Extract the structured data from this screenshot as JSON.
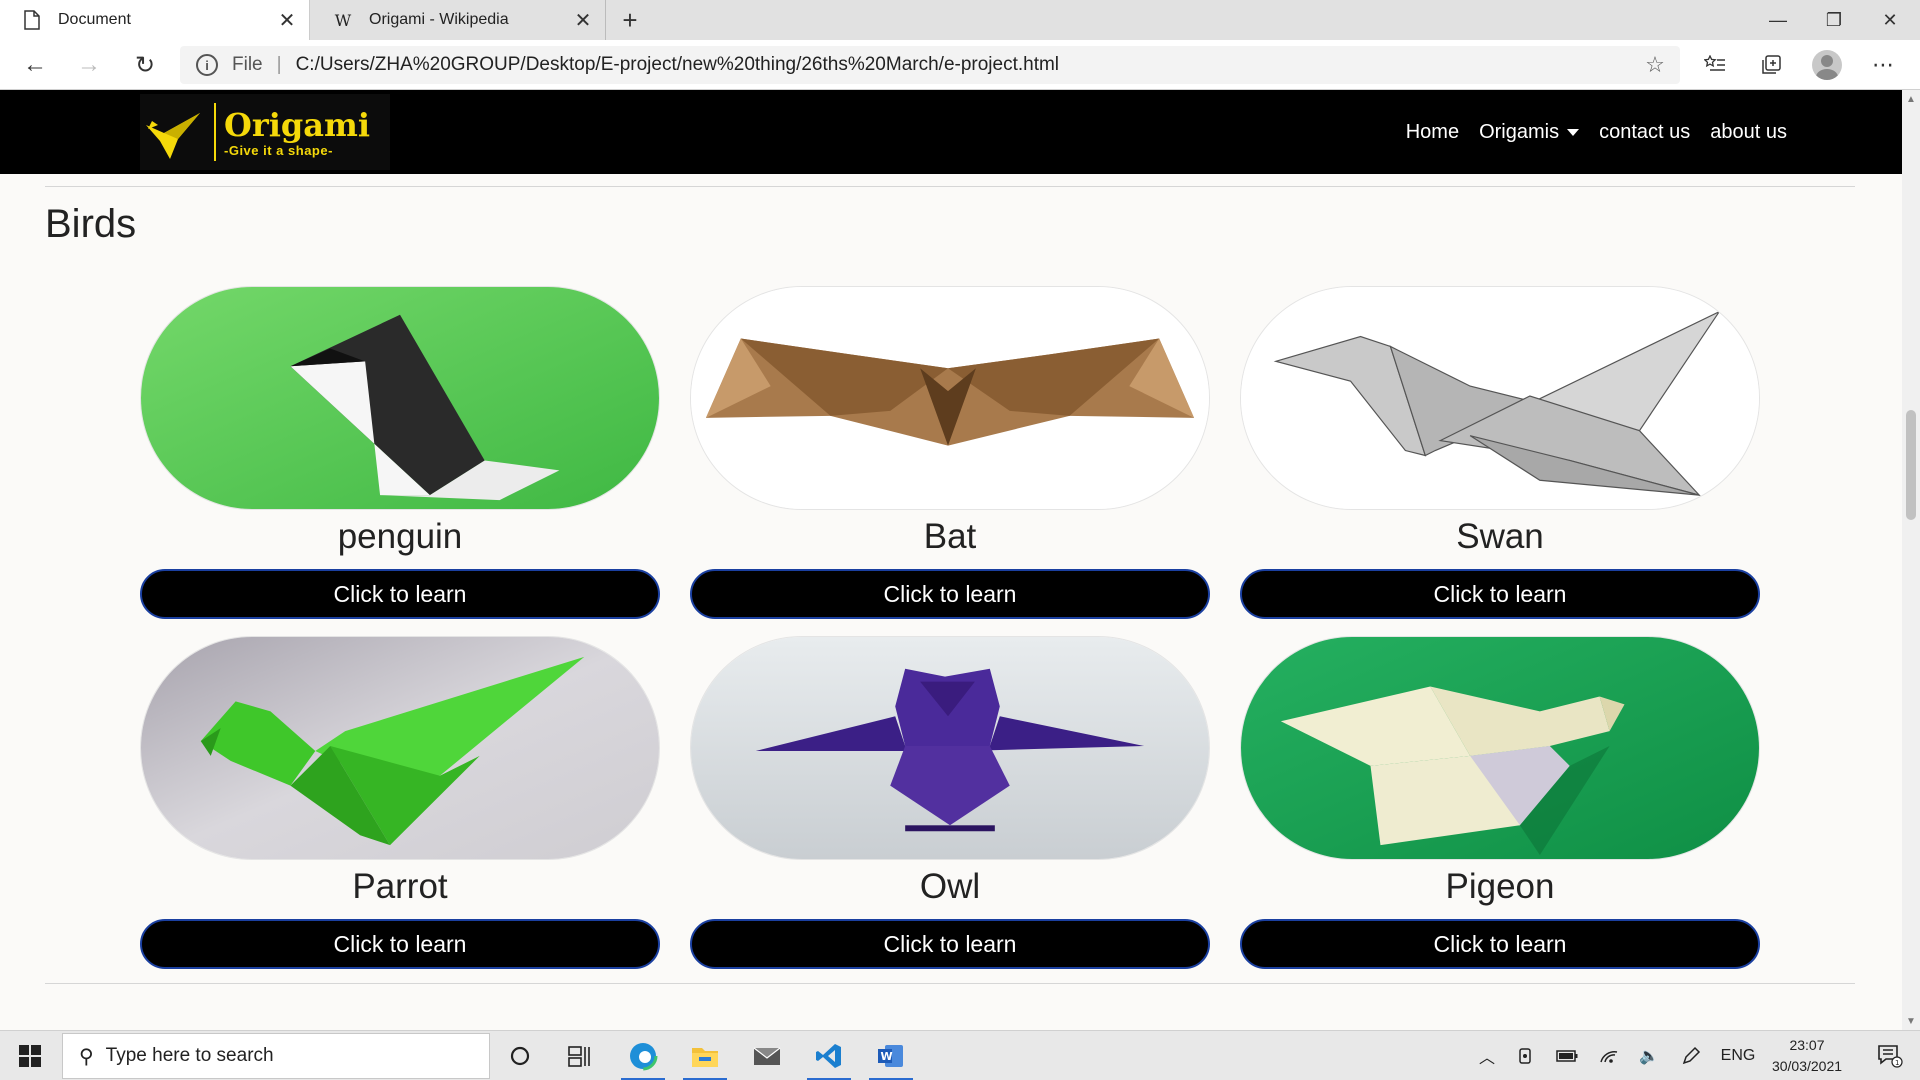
{
  "browser": {
    "tabs": [
      {
        "title": "Document",
        "icon": "page-icon"
      },
      {
        "title": "Origami - Wikipedia",
        "icon": "wikipedia-w-icon",
        "favicon_text": "W"
      }
    ],
    "address": {
      "scheme_label": "File",
      "url": "C:/Users/ZHA%20GROUP/Desktop/E-project/new%20thing/26ths%20March/e-project.html"
    }
  },
  "site": {
    "logo": {
      "name": "Origami",
      "tagline": "-Give it a shape-",
      "brand_color": "#f5d90a"
    },
    "nav": [
      {
        "label": "Home"
      },
      {
        "label": "Origamis",
        "dropdown": true
      },
      {
        "label": "contact us"
      },
      {
        "label": "about us"
      }
    ]
  },
  "section": {
    "title": "Birds",
    "cards": [
      {
        "name": "penguin",
        "button": "Click to learn",
        "image": "penguin-origami"
      },
      {
        "name": "Bat",
        "button": "Click to learn",
        "image": "bat-origami"
      },
      {
        "name": "Swan",
        "button": "Click to learn",
        "image": "swan-origami"
      },
      {
        "name": "Parrot",
        "button": "Click to learn",
        "image": "parrot-origami"
      },
      {
        "name": "Owl",
        "button": "Click to learn",
        "image": "owl-origami"
      },
      {
        "name": "Pigeon",
        "button": "Click to learn",
        "image": "pigeon-origami"
      }
    ]
  },
  "taskbar": {
    "search_placeholder": "Type here to search",
    "language": "ENG",
    "time": "23:07",
    "date": "30/03/2021",
    "notification_count": "1"
  }
}
